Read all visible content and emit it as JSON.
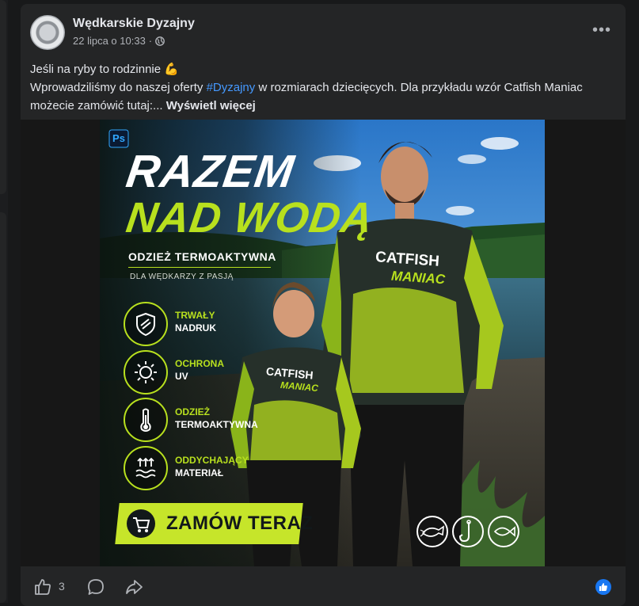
{
  "post": {
    "page_name": "Wędkarskie Dyzajny",
    "date": "22 lipca o 10:33",
    "separator": "·",
    "more_label": "•••",
    "line1": "Jeśli na ryby to rodzinnie 💪",
    "line2_before": "Wprowadziliśmy do naszej oferty ",
    "hashtag": "#Dyzajny",
    "line2_after": " w rozmiarach dziecięcych. Dla przykładu wzór Catfish Maniac możecie zamówić tutaj:... ",
    "see_more": "Wyświetl więcej"
  },
  "ad": {
    "ps_badge": "Ps",
    "headline1": "RAZEM",
    "headline2": "NAD WODĄ",
    "subtitle": "ODZIEŻ TERMOAKTYWNA",
    "tagline": "DLA WĘDKARZY Z PASJĄ",
    "features": [
      {
        "line1": "TRWAŁY",
        "line2": "NADRUK",
        "icon": "shield-icon"
      },
      {
        "line1": "OCHRONA",
        "line2": "UV",
        "icon": "sun-icon"
      },
      {
        "line1": "ODZIEŻ",
        "line2": "TERMOAKTYWNA",
        "icon": "thermometer-icon"
      },
      {
        "line1": "ODDYCHAJĄCY",
        "line2": "MATERIAŁ",
        "icon": "waves-icon"
      }
    ],
    "cta": "ZAMÓW TERAZ",
    "shirt_line1": "CATFISH",
    "shirt_line2": "MANIAC",
    "colors": {
      "accent": "#b8e01e",
      "cta_bg": "#c6e52a",
      "dark": "#12181a"
    }
  },
  "footer": {
    "like_count": "3"
  }
}
